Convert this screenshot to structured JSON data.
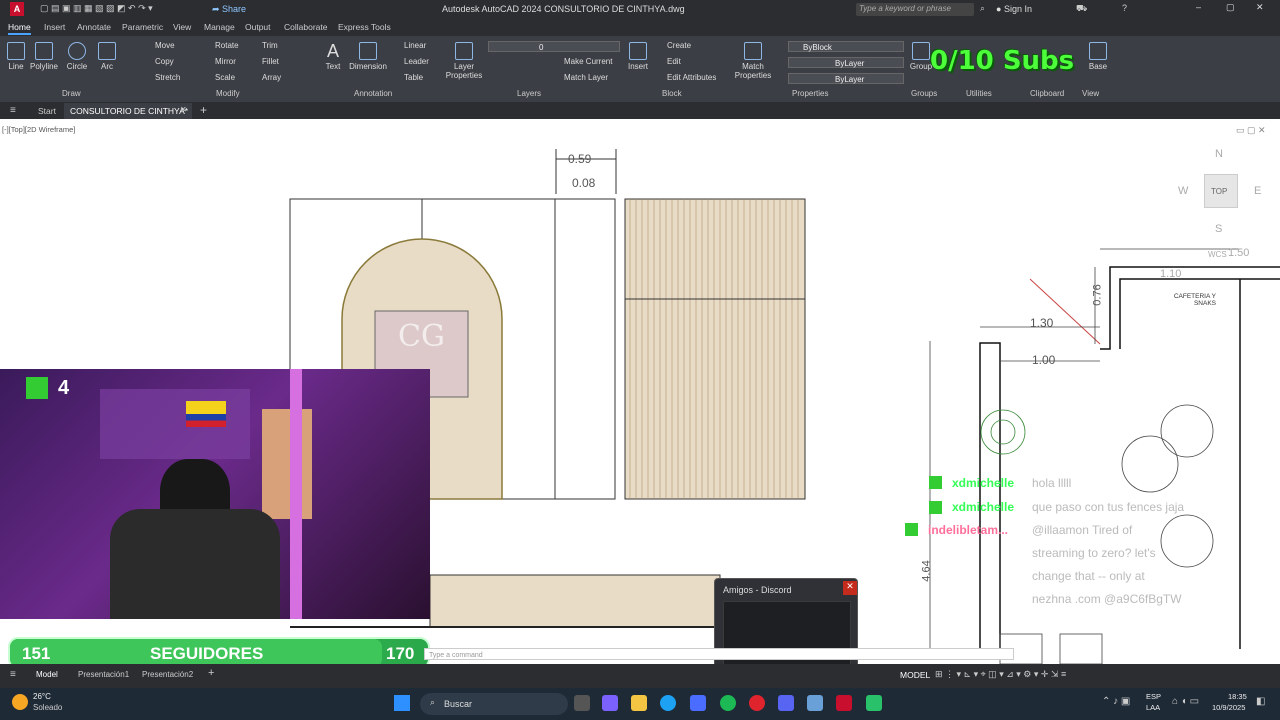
{
  "app": {
    "window_title": "Autodesk AutoCAD 2024   CONSULTORIO DE CINTHYA.dwg",
    "share_label": "Share",
    "search_placeholder": "Type a keyword or phrase",
    "sign_in": "Sign In"
  },
  "ribbon_tabs": [
    "Home",
    "Insert",
    "Annotate",
    "Parametric",
    "View",
    "Manage",
    "Output",
    "Collaborate",
    "Express Tools"
  ],
  "ribbon": {
    "draw": {
      "label": "Draw",
      "tools": [
        "Line",
        "Polyline",
        "Circle",
        "Arc"
      ]
    },
    "modify": {
      "label": "Modify",
      "items": [
        "Move",
        "Rotate",
        "Trim",
        "Copy",
        "Mirror",
        "Fillet",
        "Stretch",
        "Scale",
        "Array"
      ]
    },
    "annotation": {
      "label": "Annotation",
      "tools": [
        "Text",
        "Dimension"
      ],
      "items": [
        "Linear",
        "Leader",
        "Table"
      ]
    },
    "layers": {
      "label": "Layers",
      "tool": "Layer Properties",
      "current_layer": "0",
      "items": [
        "Make Current",
        "Match Layer"
      ]
    },
    "block": {
      "label": "Block",
      "tool": "Insert",
      "items": [
        "Create",
        "Edit",
        "Edit Attributes"
      ]
    },
    "properties": {
      "label": "Properties",
      "tool": "Match Properties",
      "bylayer_color": "ByBlock",
      "linetype": "ByLayer",
      "lineweight": "ByLayer"
    },
    "groups": {
      "label": "Groups",
      "tool": "Group"
    },
    "utilities": {
      "label": "Utilities"
    },
    "clipboard": {
      "label": "Clipboard"
    },
    "view": {
      "label": "View",
      "tool": "Base"
    }
  },
  "overlay_subs": "0/10 Subs",
  "doc_tabs": {
    "start": "Start",
    "active": "CONSULTORIO DE CINTHYA*"
  },
  "viewport_label": "[-][Top][2D Wireframe]",
  "viewcube": {
    "top": "TOP",
    "n": "N",
    "w": "W",
    "e": "E",
    "s": "S",
    "wcs": "WCS"
  },
  "dimensions": {
    "d1": "0.59",
    "d2": "0.08",
    "d3": "1.30",
    "d4": "1.00",
    "d5": "0.76",
    "d6": "1.10",
    "d7": "4.64",
    "d8": "1.50"
  },
  "room_label": "CAFETERIA Y\nSNAKS",
  "logo_letters": "CG",
  "chat": [
    {
      "user": "xdmichelle",
      "msg": "hola lllll",
      "color": "#33ff55"
    },
    {
      "user": "xdmichelle",
      "msg": "que paso con tus fences jaja",
      "color": "#33ff55"
    },
    {
      "user": "indelibletam...",
      "msg": "@illaamon Tired of",
      "color": "#ff6f9a"
    },
    {
      "user": "",
      "msg": "streaming to zero? let's",
      "color": ""
    },
    {
      "user": "",
      "msg": "change that -- only at",
      "color": ""
    },
    {
      "user": "",
      "msg": "nezhna .com @a9C6fBgTW",
      "color": ""
    }
  ],
  "webcam": {
    "badge": "4"
  },
  "followers": {
    "current": "151",
    "label": "SEGUIDORES",
    "goal": "170",
    "progress": 0.89
  },
  "discord_popup": {
    "title": "Amigos - Discord"
  },
  "command_line": "Type a command",
  "layout_tabs": [
    "Model",
    "Presentación1",
    "Presentación2"
  ],
  "status": {
    "model": "MODEL"
  },
  "taskbar": {
    "weather_temp": "26°C",
    "weather_desc": "Soleado",
    "search": "Buscar",
    "lang1": "ESP",
    "lang2": "LAA",
    "time": "18:35",
    "date": "10/9/2025"
  },
  "colors": {
    "accent": "#4aa3ff",
    "wood": "#e9dcc6",
    "green": "#3fc65a"
  }
}
